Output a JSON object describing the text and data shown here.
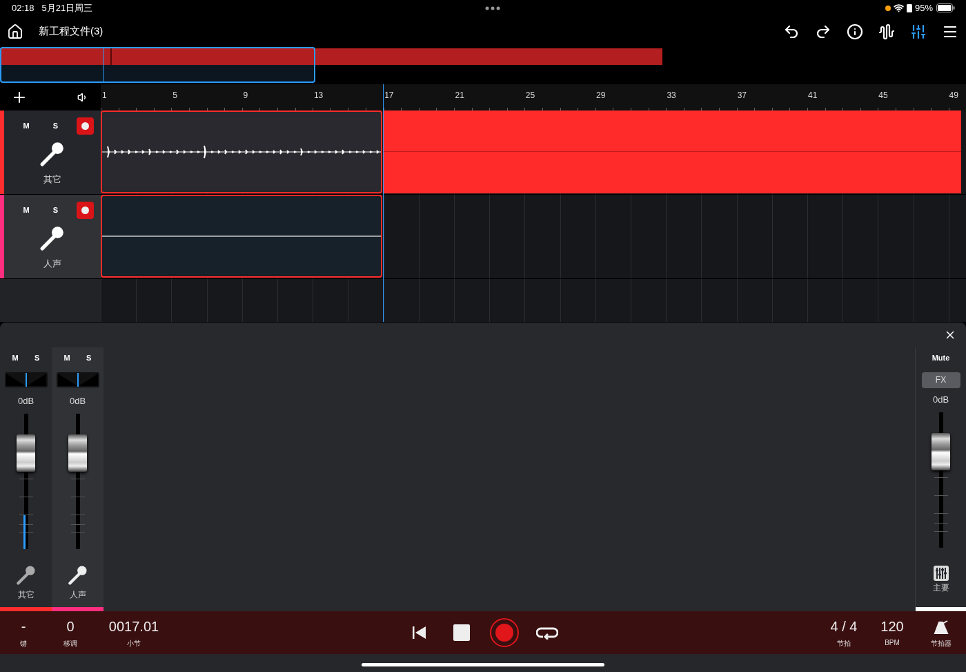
{
  "status_bar": {
    "time": "02:18",
    "date": "5月21日周三",
    "battery": "95%"
  },
  "header": {
    "title": "新工程文件(3)",
    "tools": [
      {
        "kind": "undo",
        "selected": false
      },
      {
        "kind": "redo",
        "selected": false
      },
      {
        "kind": "info",
        "selected": false
      },
      {
        "kind": "waveform",
        "selected": false
      },
      {
        "kind": "mixer",
        "selected": true
      },
      {
        "kind": "menu",
        "selected": false
      }
    ]
  },
  "ruler": {
    "marks": [
      "1",
      "5",
      "9",
      "13",
      "17",
      "21",
      "25",
      "29",
      "33",
      "37",
      "41",
      "45",
      "49"
    ]
  },
  "tracks": [
    {
      "name": "其它",
      "color": "#ff2d2d",
      "selected": false,
      "mute_label": "M",
      "solo_label": "S",
      "armed": true,
      "clip": {
        "kind": "audio"
      },
      "recording": true
    },
    {
      "name": "人声",
      "color": "#ff2e7e",
      "selected": true,
      "mute_label": "M",
      "solo_label": "S",
      "armed": true,
      "clip": {
        "kind": "silent"
      },
      "recording": false
    }
  ],
  "mixer": {
    "channels": [
      {
        "name": "其它",
        "color": "#ff2d2d",
        "selected": false,
        "mute_label": "M",
        "solo_label": "S",
        "volume": "0dB",
        "level": 0.71,
        "meter": {
          "level": 0.25
        }
      },
      {
        "name": "人声",
        "color": "#ff2e7e",
        "selected": true,
        "mute_label": "M",
        "solo_label": "S",
        "volume": "0dB",
        "level": 0.71
      }
    ],
    "master": {
      "mute_label": "Mute",
      "fx_label": "FX",
      "volume": "0dB",
      "level": 0.71,
      "name": "主要"
    }
  },
  "transport": {
    "key": {
      "value": "-",
      "label": "键"
    },
    "transpose": {
      "value": "0",
      "label": "移调"
    },
    "position": {
      "value": "0017.01",
      "label": "小节"
    },
    "recording": true,
    "time_signature": {
      "value": "4 / 4",
      "label": "节拍"
    },
    "tempo": {
      "value": "120",
      "label": "BPM"
    },
    "metronome": {
      "label": "节拍器"
    }
  }
}
